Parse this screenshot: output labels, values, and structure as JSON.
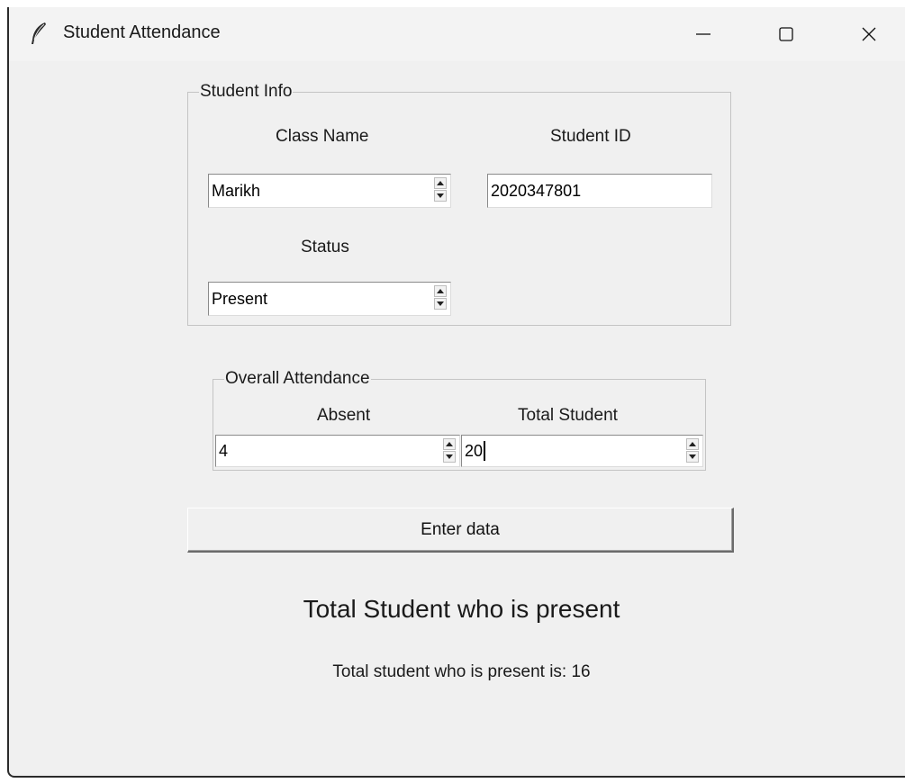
{
  "window": {
    "title": "Student Attendance",
    "icon": "feather-icon"
  },
  "student_info": {
    "legend": "Student Info",
    "class_name_label": "Class Name",
    "class_name_value": "Marikh",
    "student_id_label": "Student ID",
    "student_id_value": "2020347801",
    "status_label": "Status",
    "status_value": "Present"
  },
  "overall_attendance": {
    "legend": "Overall Attendance",
    "absent_label": "Absent",
    "absent_value": "4",
    "total_label": "Total Student",
    "total_value": "20"
  },
  "enter_button_label": "Enter data",
  "result": {
    "heading": "Total Student who is present",
    "text": "Total student who is present is: 16"
  }
}
